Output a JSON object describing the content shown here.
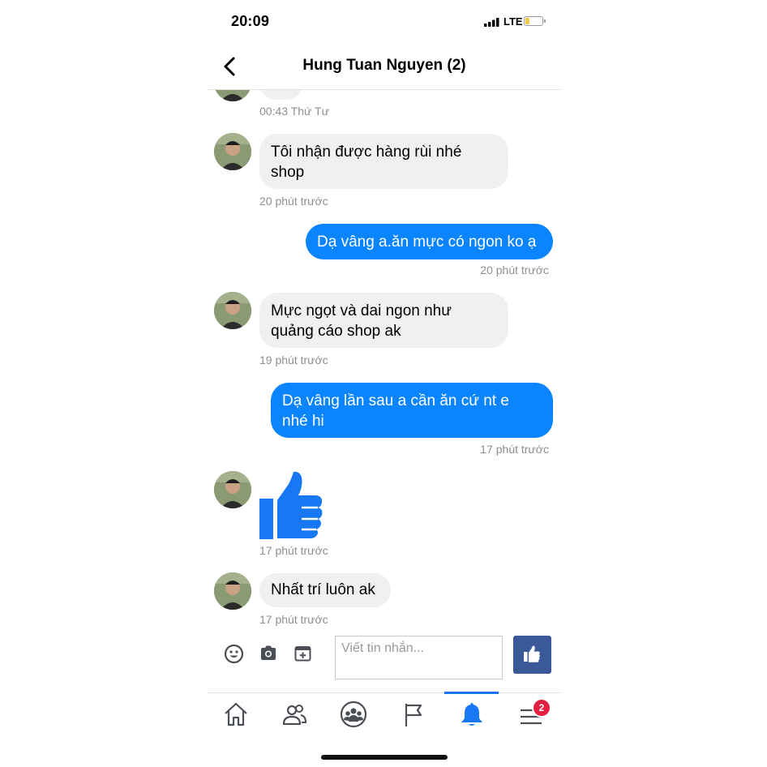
{
  "status_bar": {
    "time": "20:09",
    "network": "LTE"
  },
  "header": {
    "title": "Hung Tuan Nguyen (2)"
  },
  "thread": {
    "top_timestamp": "00:43 Thứ Tư",
    "messages": [
      {
        "from": "them",
        "text_line1": "Tôi nhận được hàng rùi nhé",
        "text_line2": "shop",
        "time": "20 phút trước"
      },
      {
        "from": "me",
        "text_line1": "Dạ vâng a.ăn mực có ngon ko ạ",
        "time": "20 phút trước"
      },
      {
        "from": "them",
        "text_line1": "Mực ngọt và dai ngon như",
        "text_line2": "quảng cáo shop ak",
        "time": "19 phút trước"
      },
      {
        "from": "me",
        "text_line1": "Dạ vâng lần sau a cần ăn cứ nt e",
        "text_line2": "nhé hi",
        "time": "17 phút trước"
      },
      {
        "from": "them",
        "sticker": "thumbs-up",
        "time": "17 phút trước"
      },
      {
        "from": "them",
        "text_line1": "Nhất trí luôn ak",
        "time": "17 phút trước"
      }
    ]
  },
  "composer": {
    "placeholder": "Viết tin nhắn..."
  },
  "tabbar": {
    "notifications_badge": "2"
  },
  "colors": {
    "outgoing": "#0a84ff",
    "incoming": "#f0f0f0",
    "facebook_blue": "#1877f2",
    "like_button": "#3b5998",
    "timestamp": "#8e8e93"
  }
}
